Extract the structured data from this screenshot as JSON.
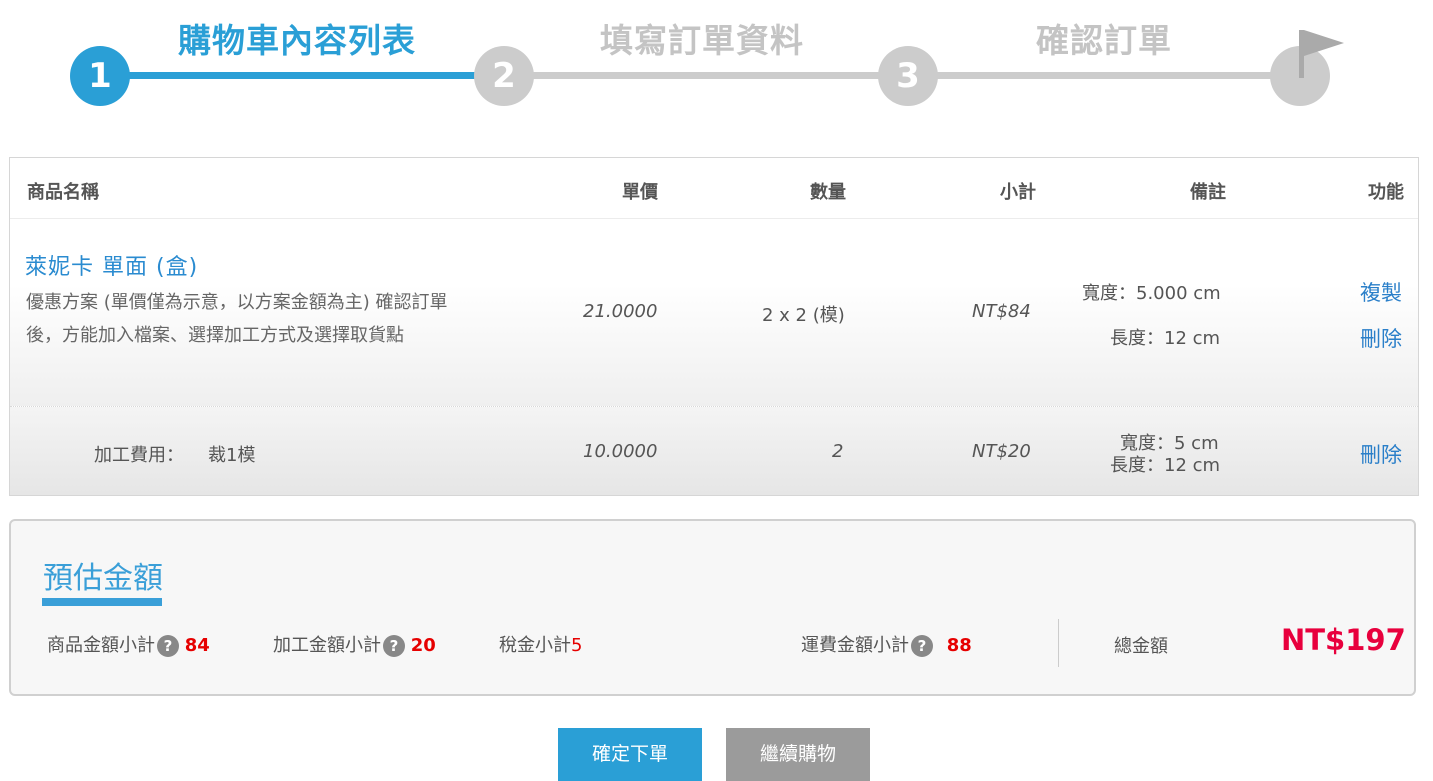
{
  "steps": [
    {
      "number": "1",
      "title": "購物車內容列表",
      "active": true
    },
    {
      "number": "2",
      "title": "填寫訂單資料",
      "active": false
    },
    {
      "number": "3",
      "title": "確認訂單",
      "active": false
    }
  ],
  "table": {
    "headers": {
      "name": "商品名稱",
      "unit_price": "單價",
      "quantity": "數量",
      "subtotal": "小計",
      "note": "備註",
      "action": "功能"
    },
    "product": {
      "name": "萊妮卡 單面 (盒)",
      "promo": "優惠方案 (單價僅為示意，以方案金額為主) 確認訂單後，方能加入檔案、選擇加工方式及選擇取貨點",
      "unit_price": "21.0000",
      "quantity": "2 x 2 (模)",
      "subtotal": "NT$84",
      "note_width": "寬度：5.000 cm",
      "note_length": "長度：12 cm",
      "copy_label": "複製",
      "delete_label": "刪除"
    },
    "processing": {
      "label": "加工費用：",
      "value": "裁1模",
      "unit_price": "10.0000",
      "quantity": "2",
      "subtotal": "NT$20",
      "note_width": "寬度：5 cm",
      "note_length": "長度：12 cm",
      "delete_label": "刪除"
    }
  },
  "estimate": {
    "title": "預估金額",
    "product_subtotal_label": "商品金額小計",
    "product_subtotal_value": "84",
    "processing_subtotal_label": "加工金額小計",
    "processing_subtotal_value": "20",
    "tax_label": "稅金小計",
    "tax_value": "5",
    "shipping_label": "運費金額小計",
    "shipping_value": "88",
    "total_label": "總金額",
    "total_value": "NT$197",
    "help_icon": "?"
  },
  "buttons": {
    "confirm": "確定下單",
    "continue": "繼續購物"
  },
  "colors": {
    "accent": "#2a9fd6",
    "inactive": "#cccccc",
    "price_red": "#e60000",
    "total_red": "#e8003d"
  }
}
